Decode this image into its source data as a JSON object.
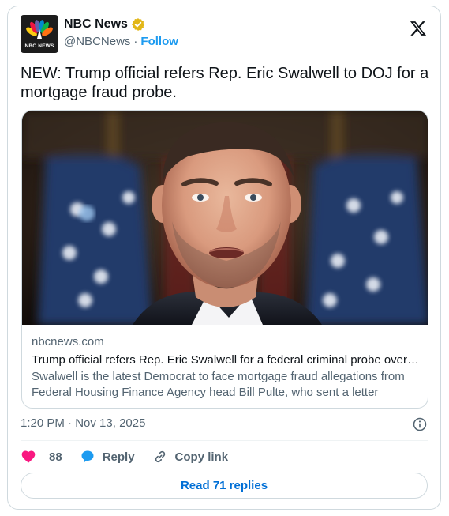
{
  "account": {
    "display_name": "NBC News",
    "handle": "@NBCNews",
    "separator": "·",
    "follow_label": "Follow",
    "avatar_text": "NBC NEWS",
    "verified": true
  },
  "tweet": {
    "text": "NEW: Trump official refers Rep. Eric Swalwell to DOJ for a mortgage fraud probe."
  },
  "link_card": {
    "domain": "nbcnews.com",
    "title": "Trump official refers Rep. Eric Swalwell for a federal criminal probe over mortgage",
    "description": "Swalwell is the latest Democrat to face mortgage fraud allegations from Federal Housing Finance Agency head Bill Pulte, who sent a letter"
  },
  "meta": {
    "time": "1:20 PM",
    "separator": " · ",
    "date": "Nov 13, 2025"
  },
  "actions": {
    "like_count": "88",
    "reply_label": "Reply",
    "copy_link_label": "Copy link"
  },
  "replies_button": "Read 71 replies",
  "colors": {
    "like": "#f91880",
    "reply": "#1d9bf0",
    "link": "#006fd6",
    "verified_gold": "#e2b719",
    "secondary_text": "#536471",
    "border": "#cfd9de"
  },
  "icons": {
    "logo": "nbc-peacock-logo",
    "verified": "verified-badge-icon",
    "x": "x-logo-icon",
    "info": "info-icon",
    "like": "heart-icon",
    "reply": "speech-bubble-icon",
    "copy": "link-icon"
  }
}
